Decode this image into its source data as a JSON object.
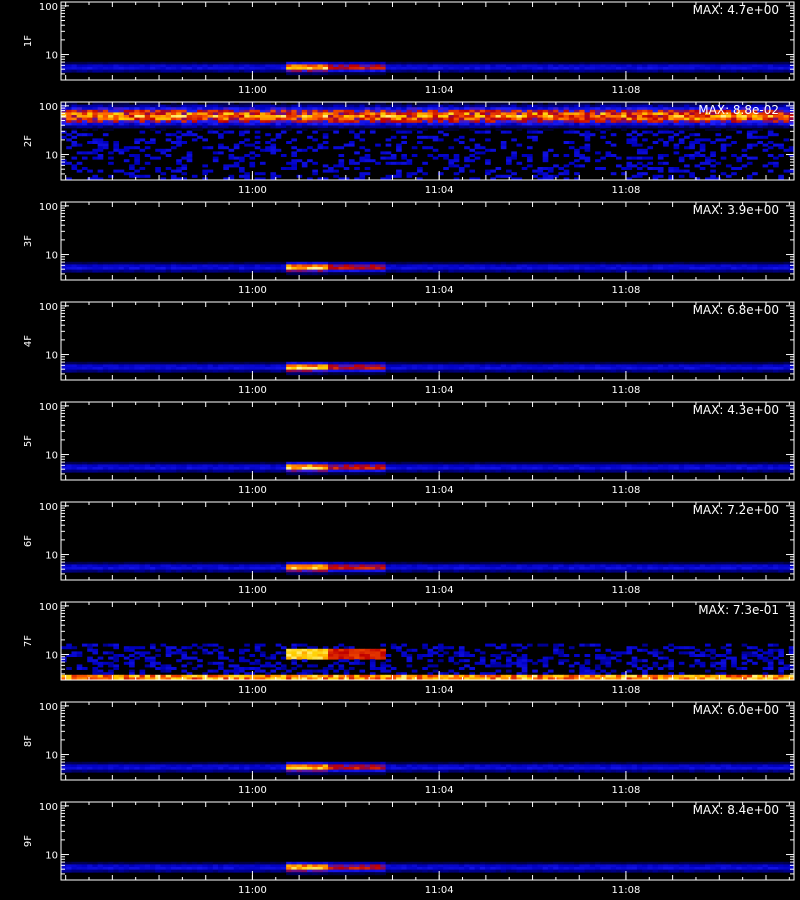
{
  "chart_data": [
    {
      "type": "heatmap",
      "ylabel": "1F",
      "max_label": "MAX: 4.7e+00",
      "pattern": "burst"
    },
    {
      "type": "heatmap",
      "ylabel": "2F",
      "max_label": "MAX: 8.8e-02",
      "pattern": "highband"
    },
    {
      "type": "heatmap",
      "ylabel": "3F",
      "max_label": "MAX: 3.9e+00",
      "pattern": "burst"
    },
    {
      "type": "heatmap",
      "ylabel": "4F",
      "max_label": "MAX: 6.8e+00",
      "pattern": "burst"
    },
    {
      "type": "heatmap",
      "ylabel": "5F",
      "max_label": "MAX: 4.3e+00",
      "pattern": "burst"
    },
    {
      "type": "heatmap",
      "ylabel": "6F",
      "max_label": "MAX: 7.2e+00",
      "pattern": "burst"
    },
    {
      "type": "heatmap",
      "ylabel": "7F",
      "max_label": "MAX: 7.3e-01",
      "pattern": "noisy"
    },
    {
      "type": "heatmap",
      "ylabel": "8F",
      "max_label": "MAX: 6.0e+00",
      "pattern": "burst"
    },
    {
      "type": "heatmap",
      "ylabel": "9F",
      "max_label": "MAX: 8.4e+00",
      "pattern": "burst"
    }
  ],
  "x_ticks": [
    "11:00",
    "11:04",
    "11:08"
  ],
  "x_tick_minutes": [
    0,
    4,
    8
  ],
  "x_range_minutes": [
    -4.1,
    11.6
  ],
  "y_ticks": [
    "10",
    "100"
  ],
  "y_tick_values": [
    10,
    100
  ],
  "y_range": [
    3,
    120
  ],
  "y_scale": "log",
  "burst_minutes": [
    0.7,
    2.9
  ],
  "colormap": [
    "#000000",
    "#0000c0",
    "#2020ff",
    "#c00000",
    "#ff6000",
    "#ffd000",
    "#ffffc0"
  ]
}
